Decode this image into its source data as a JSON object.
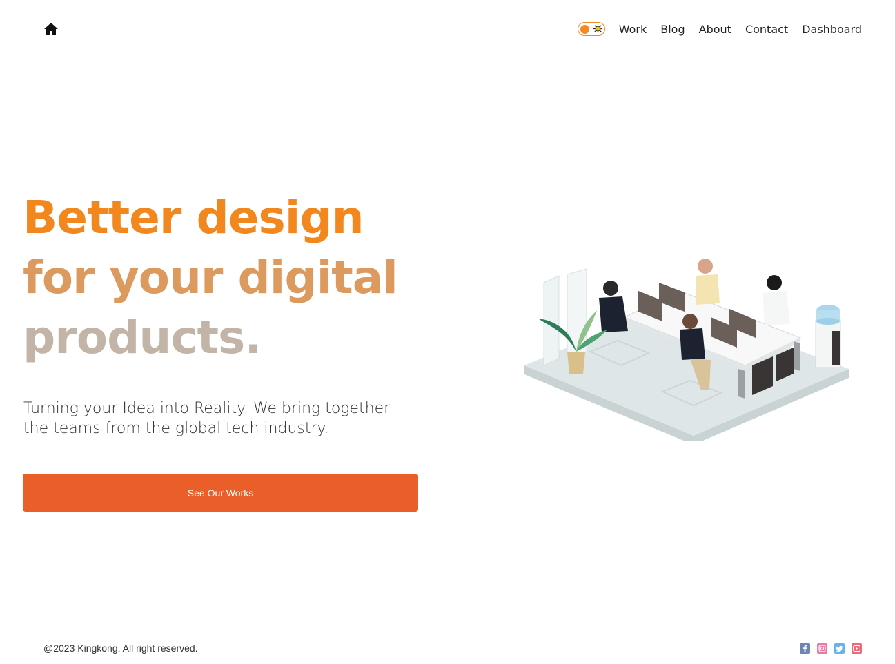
{
  "header": {
    "home_icon": "home-icon",
    "theme_toggle": {
      "icon_left": "dot",
      "icon_right": "sun-icon",
      "accent": "#f7891e"
    },
    "nav": [
      {
        "label": "Work"
      },
      {
        "label": "Blog"
      },
      {
        "label": "About"
      },
      {
        "label": "Contact"
      },
      {
        "label": "Dashboard"
      }
    ]
  },
  "hero": {
    "headline_lines": [
      "Better design",
      "for your digital",
      "products."
    ],
    "subtitle": "Turning your Idea into Reality. We bring together the teams from the global tech industry.",
    "cta_label": "See Our Works",
    "colors": {
      "line1": "#f2871e",
      "line2": "#dc9a5e",
      "line3": "#c3b4a8",
      "cta": "#e95e29"
    }
  },
  "footer": {
    "copyright": "@2023 Kingkong. All right reserved.",
    "socials": [
      "facebook-icon",
      "instagram-icon",
      "twitter-icon",
      "youtube-icon"
    ]
  }
}
